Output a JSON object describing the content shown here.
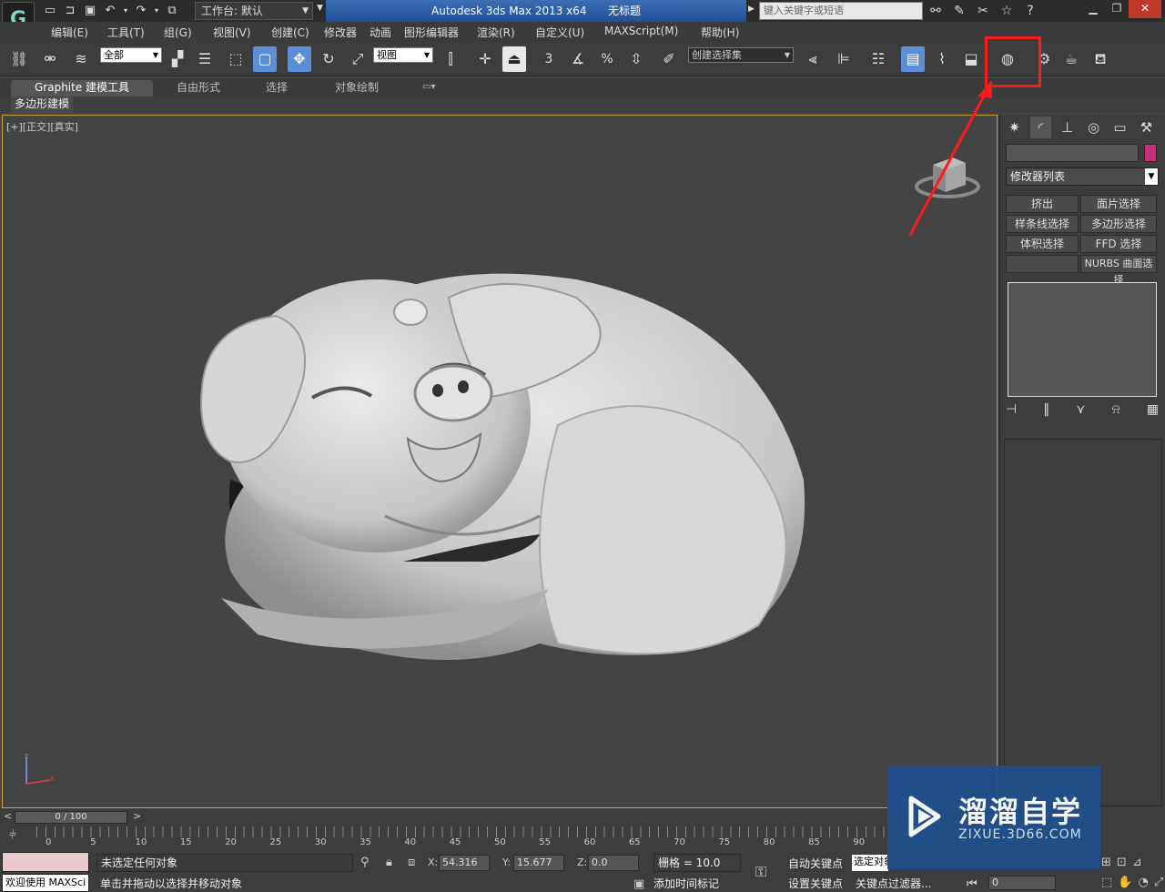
{
  "app": {
    "logo": "G",
    "workspace_label": "工作台: 默认",
    "title_app": "Autodesk 3ds Max  2013 x64",
    "title_doc": "无标题",
    "search_placeholder": "键入关键字或短语"
  },
  "menu": [
    "编辑(E)",
    "工具(T)",
    "组(G)",
    "视图(V)",
    "创建(C)",
    "修改器",
    "动画",
    "图形编辑器",
    "渲染(R)",
    "自定义(U)",
    "MAXScript(M)",
    "帮助(H)"
  ],
  "toolbar": {
    "filter_value": "全部",
    "ref_coord_value": "视图",
    "named_selection_value": "创建选择集",
    "snap_3": "3",
    "percent": "%"
  },
  "ribbon": {
    "tabs": [
      "Graphite 建模工具",
      "自由形式",
      "选择",
      "对象绘制"
    ],
    "sub_label": "多边形建模"
  },
  "viewport": {
    "label": "[+][正交][真实]"
  },
  "command_panel": {
    "modifier_list": "修改器列表",
    "buttons": [
      "挤出",
      "面片选择",
      "样条线选择",
      "多边形选择",
      "体积选择",
      "FFD 选择",
      "",
      "NURBS 曲面选择"
    ]
  },
  "timeline": {
    "slider_text": "0 / 100",
    "ticks": [
      "0",
      "5",
      "10",
      "15",
      "20",
      "25",
      "30",
      "35",
      "40",
      "45",
      "50",
      "55",
      "60",
      "65",
      "70",
      "75",
      "80",
      "85",
      "90"
    ]
  },
  "status": {
    "welcome": "欢迎使用 MAXSci",
    "line1": "未选定任何对象",
    "line2": "单击并拖动以选择并移动对象",
    "x_label": "X:",
    "x_value": "54.316",
    "y_label": "Y:",
    "y_value": "15.677",
    "z_label": "Z:",
    "z_value": "0.0",
    "grid": "栅格 = 10.0",
    "add_time_tag": "添加时间标记",
    "auto_key": "自动关键点",
    "set_key": "设置关键点",
    "selection_drop": "选定对象",
    "key_filter": "关键点过滤器...",
    "frame": "0"
  },
  "watermark": {
    "name": "溜溜自学",
    "url": "ZIXUE.3D66.COM"
  },
  "colors": {
    "annotation": "#ff1a1a",
    "viewport_border": "#c9a52b",
    "object_color": "#c72d7a",
    "title_blue": "#2a5ba3"
  }
}
